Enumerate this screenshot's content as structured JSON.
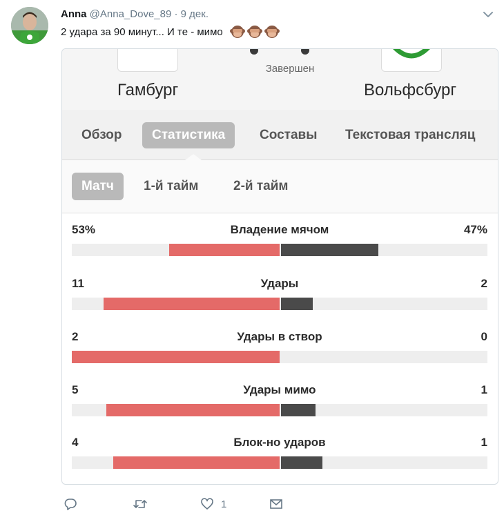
{
  "tweet": {
    "author_name": "Anna",
    "handle": "@Anna_Dove_89",
    "separator": "·",
    "date": "9 дек.",
    "text": "2 удара за 90 минут... И те - мимо",
    "emoji": "see-no-evil-monkey",
    "emoji_count": 3,
    "like_count": "1"
  },
  "match": {
    "home_team": "Гамбург",
    "away_team": "Вольфсбург",
    "status": "Завершен"
  },
  "tabs": [
    "Обзор",
    "Статистика",
    "Составы",
    "Текстовая трансляц"
  ],
  "active_tab": "Статистика",
  "subtabs": [
    "Матч",
    "1-й тайм",
    "2-й тайм"
  ],
  "active_subtab": "Матч",
  "stats": [
    {
      "label": "Владение мячом",
      "home": "53%",
      "away": "47%",
      "home_value": 53,
      "away_value": 47,
      "max": 100
    },
    {
      "label": "Удары",
      "home": "11",
      "away": "2",
      "home_value": 11,
      "away_value": 2,
      "max": 13
    },
    {
      "label": "Удары в створ",
      "home": "2",
      "away": "0",
      "home_value": 2,
      "away_value": 0,
      "max": 2
    },
    {
      "label": "Удары мимо",
      "home": "5",
      "away": "1",
      "home_value": 5,
      "away_value": 1,
      "max": 6
    },
    {
      "label": "Блок-но ударов",
      "home": "4",
      "away": "1",
      "home_value": 4,
      "away_value": 1,
      "max": 5
    }
  ],
  "colors": {
    "home_bar": "#e46a68",
    "away_bar": "#4a4a4a",
    "track": "#eeeeee",
    "twitter_gray": "#657786"
  },
  "icons": {
    "reply": "reply-icon",
    "retweet": "retweet-icon",
    "like": "heart-icon",
    "dm": "envelope-icon",
    "menu": "chevron-down-icon"
  }
}
